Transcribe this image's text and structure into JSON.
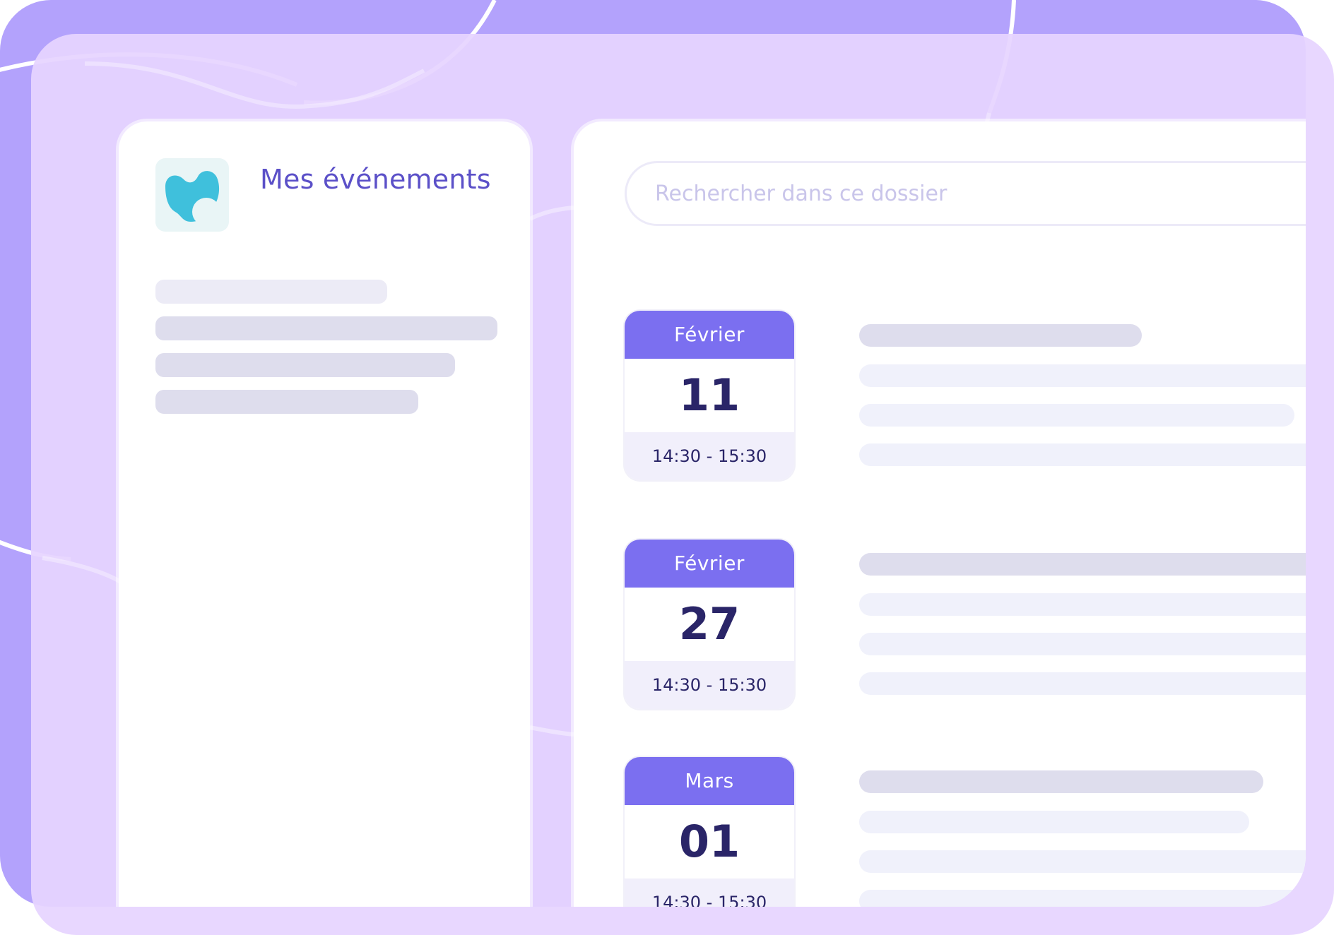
{
  "app": {
    "title": "Mes événements",
    "logo_icon": "blob-logo-icon"
  },
  "search": {
    "placeholder": "Rechercher dans ce dossier"
  },
  "events": [
    {
      "month": "Février",
      "day": "11",
      "time": "14:30 - 15:30"
    },
    {
      "month": "Février",
      "day": "27",
      "time": "14:30 - 15:30"
    },
    {
      "month": "Mars",
      "day": "01",
      "time": "14:30 - 15:30"
    }
  ],
  "colors": {
    "back_window": "#b3a2fc",
    "front_window": "#e6d4ff",
    "accent": "#7b6ff0",
    "title_text": "#5b50c8",
    "date_text": "#2a2568",
    "logo_teal": "#3fc0dc"
  }
}
